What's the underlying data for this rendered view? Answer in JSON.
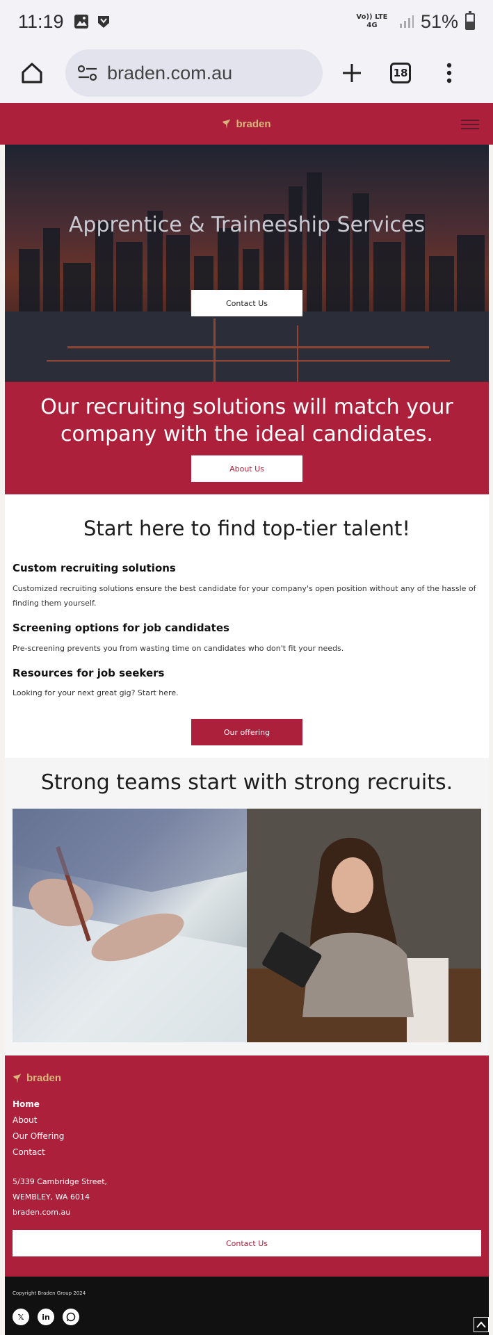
{
  "status_bar": {
    "time": "11:19",
    "network": "Vo)) LTE 4G",
    "battery": "51%",
    "battery_level": 0.51
  },
  "browser": {
    "url": "braden.com.au",
    "tab_count": "18"
  },
  "site": {
    "logo_text": "braden"
  },
  "hero": {
    "title": "Apprentice & Traineeship Services",
    "button": "Contact Us"
  },
  "band": {
    "text": "Our recruiting solutions will match your company with the ideal candidates.",
    "button": "About Us"
  },
  "talent": {
    "heading": "Start here to find top-tier talent!",
    "items": [
      {
        "title": "Custom recruiting solutions",
        "text": "Customized recruiting solutions ensure the best candidate for your company's open position without any of the hassle of finding them yourself."
      },
      {
        "title": "Screening options for job candidates",
        "text": "Pre-screening prevents you from wasting time on candidates who don't fit your needs."
      },
      {
        "title": "Resources for job seekers",
        "text": "Looking for your next great gig? Start here."
      }
    ],
    "button": "Our offering"
  },
  "teams": {
    "heading": "Strong teams start with strong recruits."
  },
  "footer": {
    "nav": [
      "Home",
      "About",
      "Our Offering",
      "Contact"
    ],
    "address_line1": "5/339 Cambridge Street,",
    "address_line2": "WEMBLEY, WA 6014",
    "website": "braden.com.au",
    "button": "Contact Us",
    "copyright": "Copyright Braden Group 2024"
  },
  "colors": {
    "brand": "#ad203b",
    "logo": "#d8b57a"
  }
}
